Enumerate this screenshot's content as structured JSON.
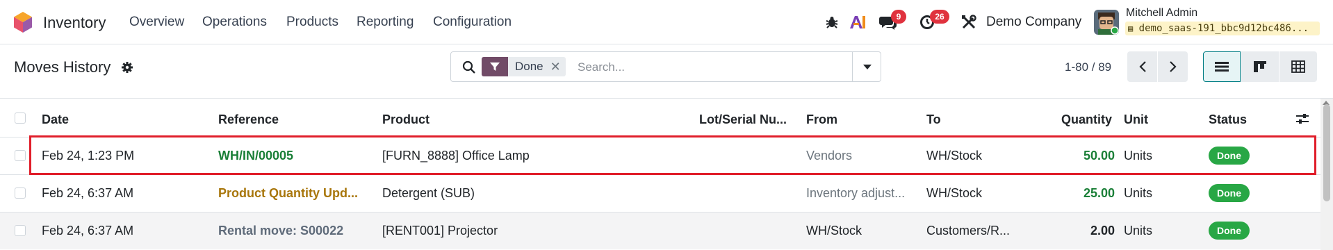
{
  "app": {
    "name": "Inventory"
  },
  "menu": [
    "Overview",
    "Operations",
    "Products",
    "Reporting",
    "Configuration"
  ],
  "systray": {
    "messages_count": "9",
    "activities_count": "26",
    "company": "Demo Company",
    "user_name": "Mitchell Admin",
    "database": "demo_saas-191_bbc9d12bc486..."
  },
  "page": {
    "title": "Moves History"
  },
  "search": {
    "facet_label": "Done",
    "placeholder": "Search..."
  },
  "pager": {
    "value": "1-80 / 89"
  },
  "columns": {
    "date": "Date",
    "reference": "Reference",
    "product": "Product",
    "lot": "Lot/Serial Nu...",
    "from": "From",
    "to": "To",
    "quantity": "Quantity",
    "unit": "Unit",
    "status": "Status"
  },
  "rows": [
    {
      "date": "Feb 24, 1:23 PM",
      "reference": "WH/IN/00005",
      "product": "[FURN_8888] Office Lamp",
      "lot": "",
      "from": "Vendors",
      "to": "WH/Stock",
      "quantity": "50.00",
      "unit": "Units",
      "status": "Done"
    },
    {
      "date": "Feb 24, 6:37 AM",
      "reference": "Product Quantity Upd...",
      "product": "Detergent (SUB)",
      "lot": "",
      "from": "Inventory adjust...",
      "to": "WH/Stock",
      "quantity": "25.00",
      "unit": "Units",
      "status": "Done"
    },
    {
      "date": "Feb 24, 6:37 AM",
      "reference": "Rental move: S00022",
      "product": "[RENT001] Projector",
      "lot": "",
      "from": "WH/Stock",
      "to": "Customers/R...",
      "quantity": "2.00",
      "unit": "Units",
      "status": "Done"
    }
  ],
  "colors": {
    "brand": "#714b67",
    "accent": "#017e84",
    "done_badge": "#28a745",
    "badge_red": "#e0323e",
    "highlight": "#e01e2a"
  }
}
